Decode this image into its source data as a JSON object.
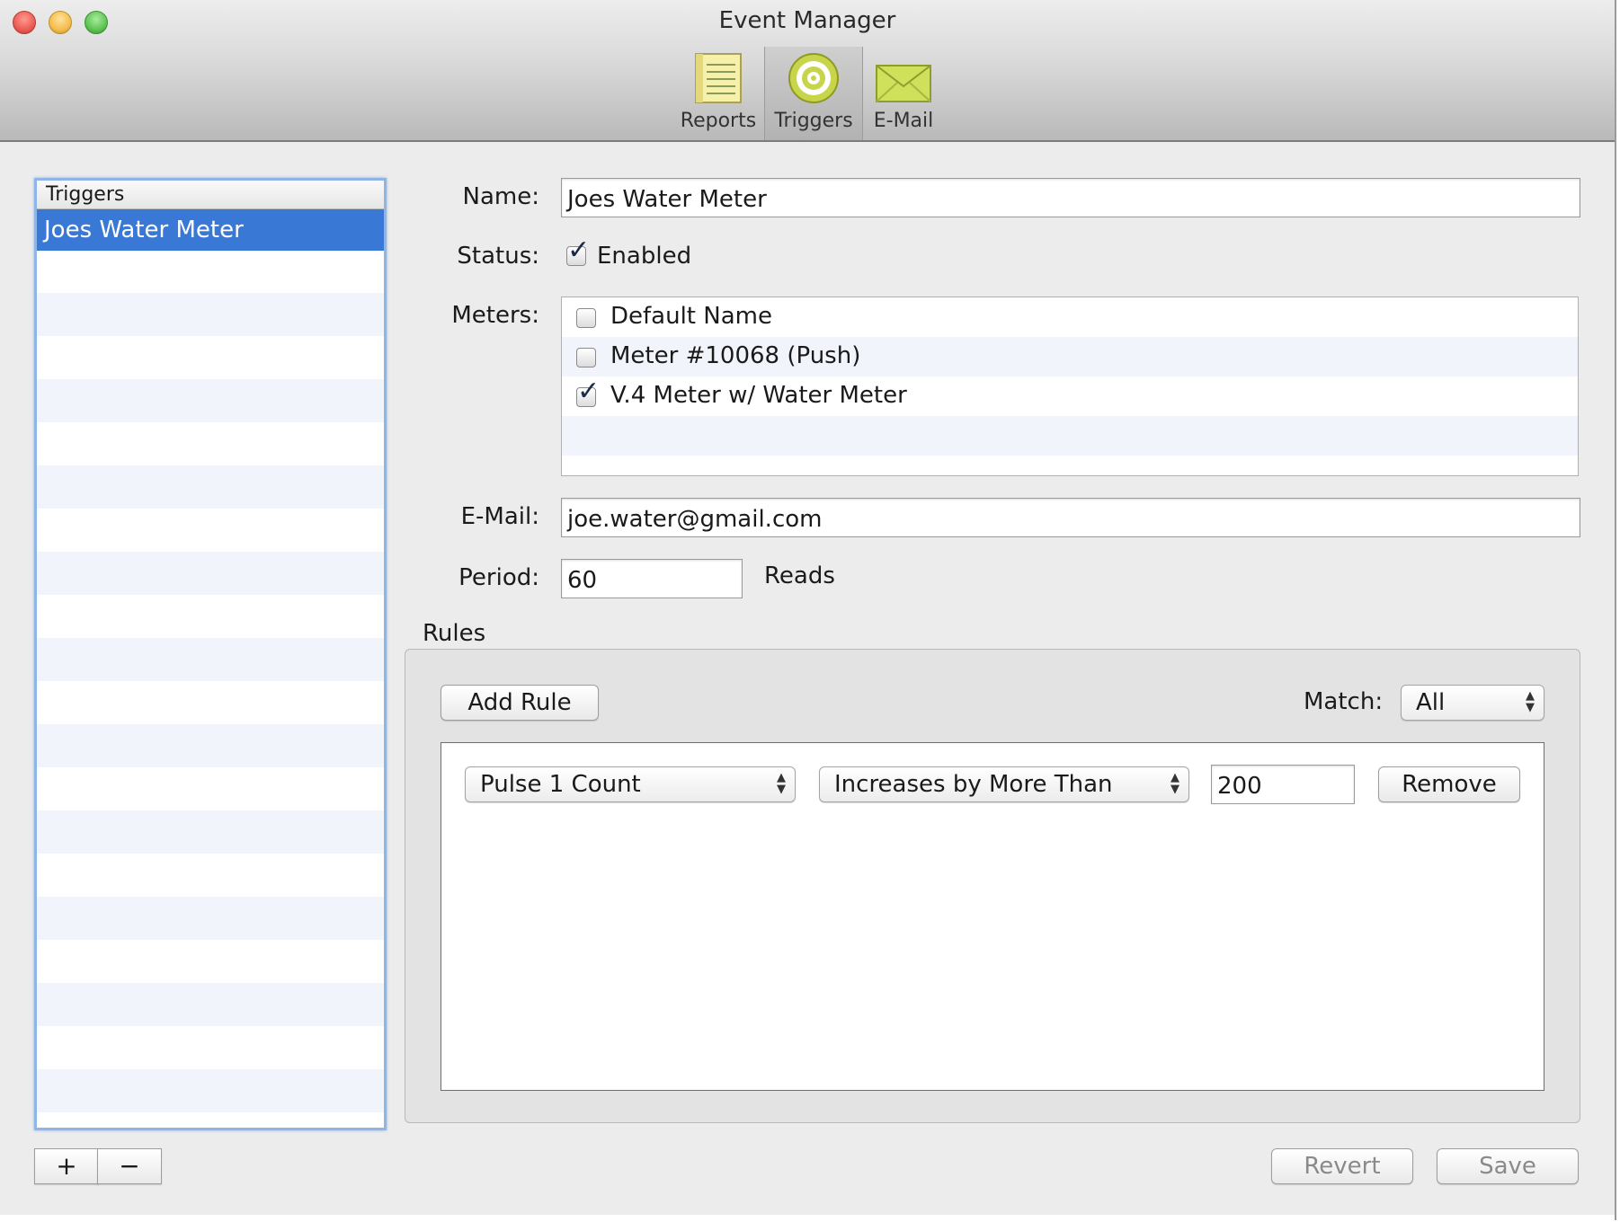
{
  "window": {
    "title": "Event Manager",
    "traffic_lights": [
      "#ec5c53",
      "#f4bd4f",
      "#5fc454"
    ]
  },
  "toolbar": {
    "items": [
      {
        "label": "Reports",
        "icon": "notepad-icon"
      },
      {
        "label": "Triggers",
        "icon": "target-icon",
        "selected": true
      },
      {
        "label": "E-Mail",
        "icon": "envelope-icon"
      }
    ]
  },
  "sidebar": {
    "header": "Triggers",
    "items": [
      "Joes Water Meter"
    ],
    "selected_index": 0,
    "add_label": "+",
    "remove_label": "−"
  },
  "form": {
    "name_label": "Name:",
    "name_value": "Joes Water Meter",
    "status_label": "Status:",
    "status_checkbox_label": "Enabled",
    "status_checked": true,
    "meters_label": "Meters:",
    "meters": [
      {
        "name": "Default Name",
        "checked": false
      },
      {
        "name": "Meter #10068 (Push)",
        "checked": false
      },
      {
        "name": "V.4 Meter w/ Water Meter",
        "checked": true
      }
    ],
    "email_label": "E-Mail:",
    "email_value": "joe.water@gmail.com",
    "period_label": "Period:",
    "period_value": "60",
    "period_unit": "Reads"
  },
  "rules": {
    "title": "Rules",
    "add_rule_label": "Add Rule",
    "match_label": "Match:",
    "match_value": "All",
    "items": [
      {
        "field": "Pulse 1 Count",
        "operator": "Increases by More Than",
        "value": "200",
        "remove_label": "Remove"
      }
    ]
  },
  "actions": {
    "revert_label": "Revert",
    "save_label": "Save"
  },
  "colors": {
    "selection": "#3a78d6",
    "focus_ring": "#8fb5e6",
    "row_stripe": "#f1f5fb"
  }
}
